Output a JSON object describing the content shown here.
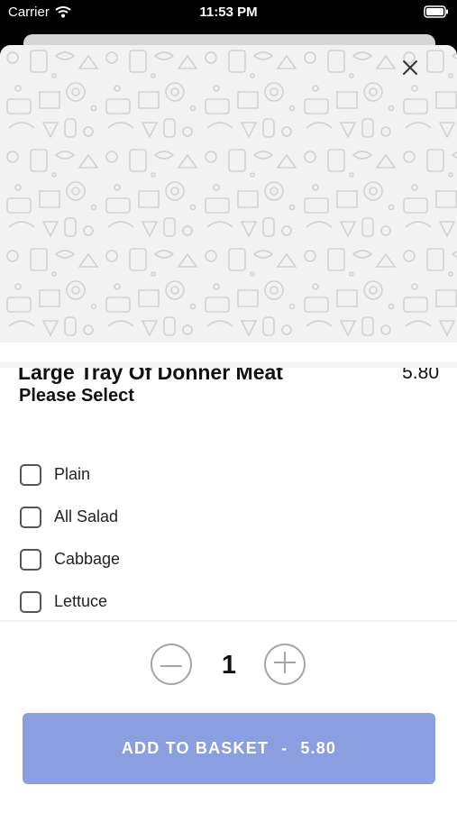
{
  "status_bar": {
    "carrier": "Carrier",
    "time": "11:53 PM"
  },
  "item": {
    "name": "Large Tray Of Donner Meat",
    "price": "5.80"
  },
  "options": {
    "title": "Please Select",
    "items": [
      {
        "label": "Plain",
        "checked": false
      },
      {
        "label": "All Salad",
        "checked": false
      },
      {
        "label": "Cabbage",
        "checked": false
      },
      {
        "label": "Lettuce",
        "checked": false
      }
    ]
  },
  "quantity": {
    "value": "1",
    "decrement_icon": "minus-icon",
    "increment_icon": "plus-icon"
  },
  "add_button": {
    "label": "ADD TO BASKET",
    "separator": "-",
    "price": "5.80"
  },
  "icons": {
    "close": "close-icon",
    "wifi": "wifi-icon",
    "battery": "battery-icon"
  },
  "colors": {
    "accent": "#8b9fe0",
    "pattern_bg": "#f2f2f2"
  }
}
